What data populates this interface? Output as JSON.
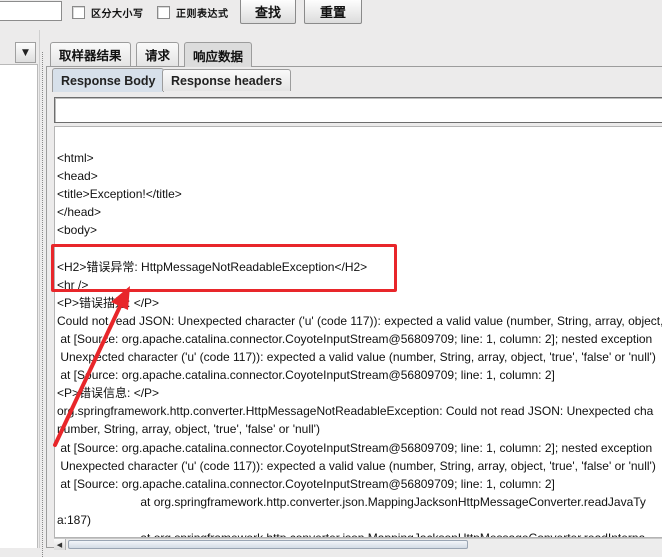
{
  "toolbar": {
    "search_value": "",
    "case_sensitive_label": "区分大小写",
    "regex_label": "正则表达式",
    "find_button": "查找",
    "reset_button": "重置"
  },
  "left_panel": {
    "dropdown_icon": "▼"
  },
  "result_tabs": [
    {
      "label": "取样器结果",
      "active": false
    },
    {
      "label": "请求",
      "active": false
    },
    {
      "label": "响应数据",
      "active": true
    }
  ],
  "response_tabs": [
    {
      "label": "Response Body",
      "active": true
    },
    {
      "label": "Response headers",
      "active": false
    }
  ],
  "find_field_value": "",
  "response_lines": [
    "<html>",
    "<head>",
    "<title>Exception!</title>",
    "</head>",
    "<body>",
    "",
    "<H2>错误异常: HttpMessageNotReadableException</H2>",
    "<hr />",
    "<P>错误描述: </P>",
    "Could not read JSON: Unexpected character ('u' (code 117)): expected a valid value (number, String, array, object,",
    " at [Source: org.apache.catalina.connector.CoyoteInputStream@56809709; line: 1, column: 2]; nested exception",
    " Unexpected character ('u' (code 117)): expected a valid value (number, String, array, object, 'true', 'false' or 'null')",
    " at [Source: org.apache.catalina.connector.CoyoteInputStream@56809709; line: 1, column: 2]",
    "<P>错误信息: </P>",
    "org.springframework.http.converter.HttpMessageNotReadableException: Could not read JSON: Unexpected cha",
    "number, String, array, object, 'true', 'false' or 'null')",
    " at [Source: org.apache.catalina.connector.CoyoteInputStream@56809709; line: 1, column: 2]; nested exception",
    " Unexpected character ('u' (code 117)): expected a valid value (number, String, array, object, 'true', 'false' or 'null')",
    " at [Source: org.apache.catalina.connector.CoyoteInputStream@56809709; line: 1, column: 2]",
    "                         at org.springframework.http.converter.json.MappingJacksonHttpMessageConverter.readJavaTy",
    "a:187)",
    "                         at org.springframework.http.converter.json.MappingJacksonHttpMessageConverter.readInterna"
  ],
  "colors": {
    "annotation": "#e8262a",
    "active_subtab": "#d7e0ea"
  }
}
